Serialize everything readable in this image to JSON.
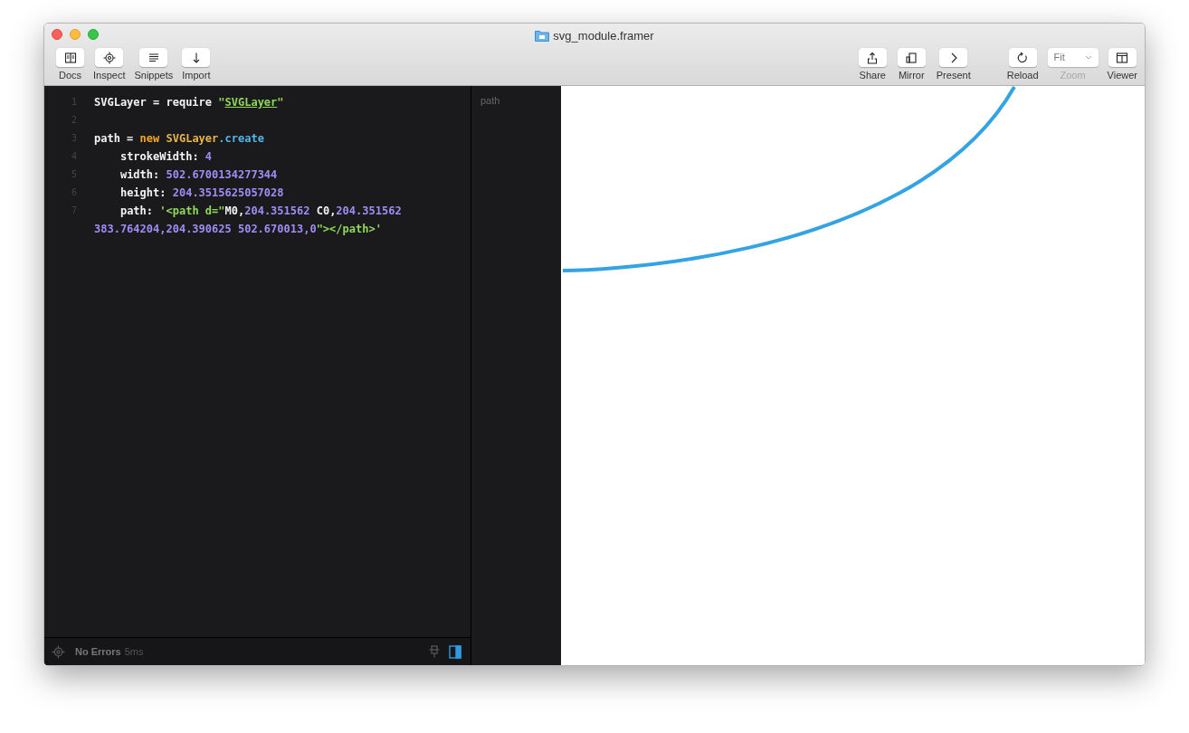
{
  "window": {
    "title": "svg_module.framer"
  },
  "toolbar_left": [
    {
      "label": "Docs"
    },
    {
      "label": "Inspect"
    },
    {
      "label": "Snippets"
    },
    {
      "label": "Import"
    }
  ],
  "toolbar_middle": [
    {
      "label": "Share"
    },
    {
      "label": "Mirror"
    },
    {
      "label": "Present"
    }
  ],
  "reload": {
    "label": "Reload"
  },
  "zoom": {
    "value": "Fit",
    "label": "Zoom",
    "disabled": true
  },
  "viewer": {
    "label": "Viewer"
  },
  "code_lines": [
    {
      "number": "1",
      "tokens": [
        {
          "kind": "plain",
          "text": "SVGLayer = require "
        },
        {
          "kind": "string",
          "text": "\""
        },
        {
          "kind": "link",
          "text": "SVGLayer"
        },
        {
          "kind": "string",
          "text": "\""
        }
      ]
    },
    {
      "number": "2"
    },
    {
      "number": "3",
      "tokens": [
        {
          "kind": "plain",
          "text": "path = "
        },
        {
          "kind": "keyword",
          "text": "new "
        },
        {
          "kind": "class",
          "text": "SVGLayer"
        },
        {
          "kind": "method",
          "text": ".create"
        }
      ]
    },
    {
      "number": "4",
      "tokens": [
        {
          "kind": "plain",
          "text": "    strokeWidth: "
        },
        {
          "kind": "number",
          "text": "4"
        }
      ]
    },
    {
      "number": "5",
      "tokens": [
        {
          "kind": "plain",
          "text": "    width: "
        },
        {
          "kind": "number",
          "text": "502.6700134277344"
        }
      ]
    },
    {
      "number": "6",
      "tokens": [
        {
          "kind": "plain",
          "text": "    height: "
        },
        {
          "kind": "number",
          "text": "204.3515625057028"
        }
      ]
    },
    {
      "number": "7",
      "tokens": [
        {
          "kind": "plain",
          "text": "    path: "
        },
        {
          "kind": "string",
          "text": "'<path d=\""
        },
        {
          "kind": "plain",
          "text": "M0,"
        },
        {
          "kind": "number",
          "text": "204.351562"
        },
        {
          "kind": "plain",
          "text": " C0,"
        },
        {
          "kind": "number",
          "text": "204.351562 383.764204,204.390625 502.670013,0"
        },
        {
          "kind": "string",
          "text": "\"></path>'"
        }
      ]
    }
  ],
  "status_bar": {
    "message": "No Errors",
    "time": "5ms"
  },
  "layers": [
    {
      "name": "path"
    }
  ]
}
